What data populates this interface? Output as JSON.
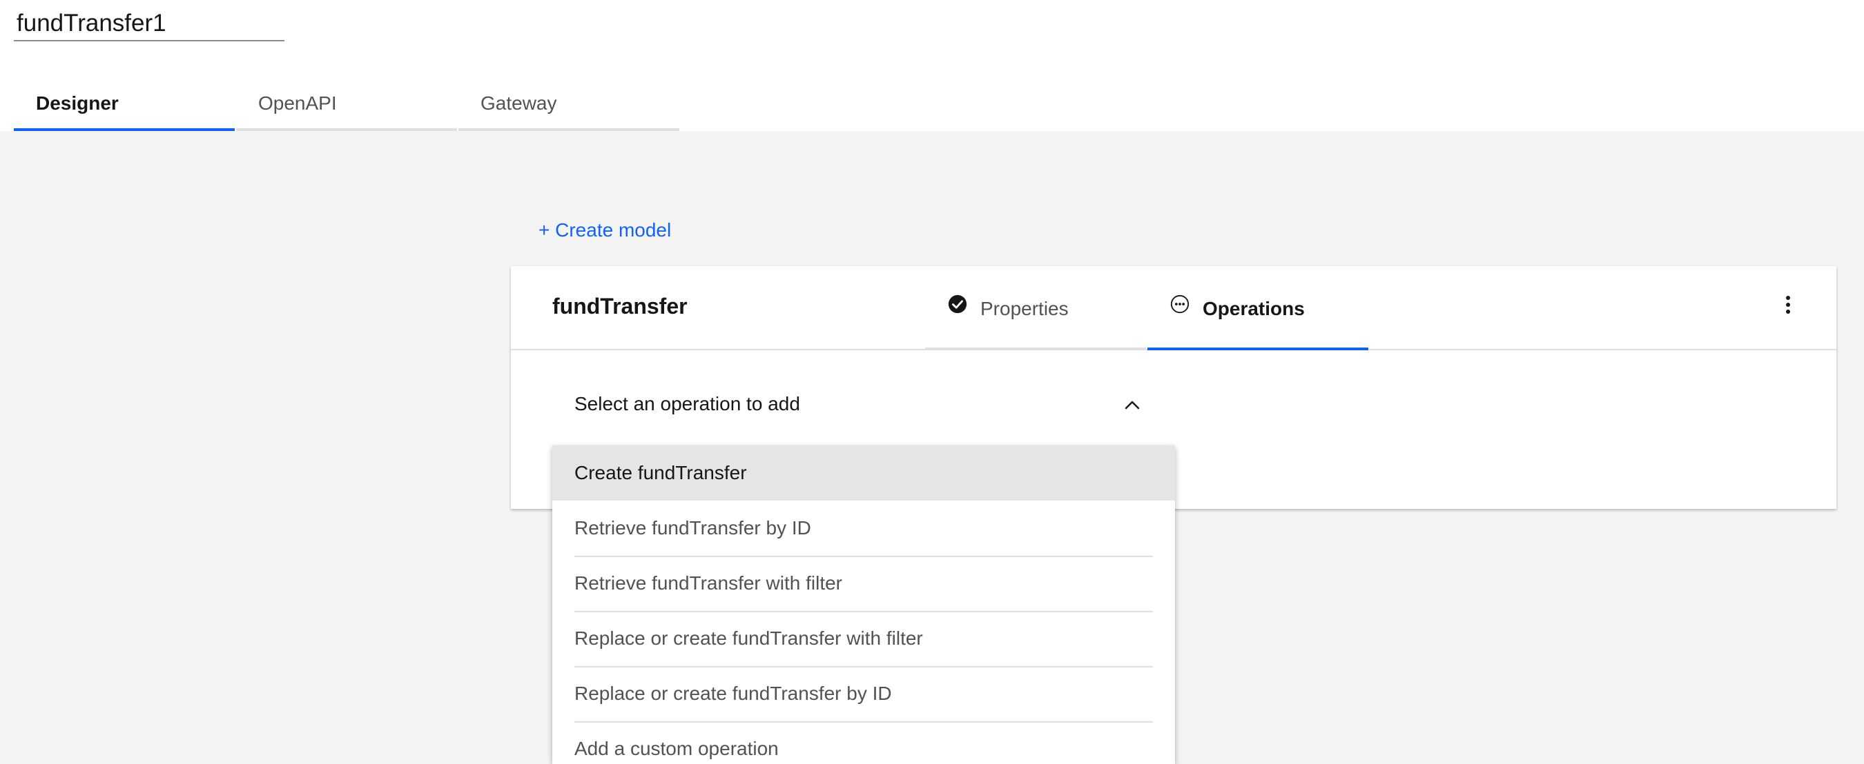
{
  "api": {
    "name": "fundTransfer1"
  },
  "top_tabs": [
    {
      "label": "Designer",
      "active": true
    },
    {
      "label": "OpenAPI",
      "active": false
    },
    {
      "label": "Gateway",
      "active": false
    }
  ],
  "designer": {
    "create_model_label": "+ Create model",
    "model": {
      "name": "fundTransfer",
      "tabs": [
        {
          "label": "Properties",
          "icon": "checkmark-filled-icon",
          "active": false
        },
        {
          "label": "Operations",
          "icon": "overflow-circle-icon",
          "active": true
        }
      ],
      "overflow_icon": "overflow-menu-vertical-icon"
    },
    "operation_select": {
      "placeholder": "Select an operation to add",
      "expanded": true,
      "options": [
        "Create fundTransfer",
        "Retrieve fundTransfer by ID",
        "Retrieve fundTransfer with filter",
        "Replace or create fundTransfer with filter",
        "Replace or create fundTransfer by ID",
        "Add a custom operation"
      ],
      "highlighted_index": 0
    }
  },
  "colors": {
    "accent": "#0f62fe",
    "background": "#f4f4f4",
    "text_primary": "#161616",
    "text_secondary": "#525252",
    "highlight": "#e5e5e5"
  }
}
